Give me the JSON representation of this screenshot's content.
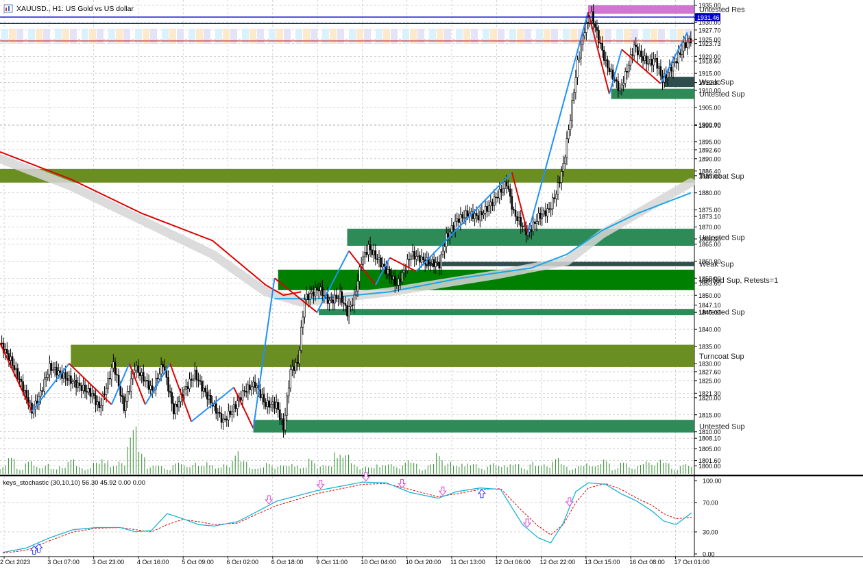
{
  "window": {
    "symbol_title": "XAUUSD., H1:  US Gold vs US dollar",
    "icon": "chart-window-icon"
  },
  "colors": {
    "bull_wick": "#000000",
    "zigzag_up": "#1e90ff",
    "zigzag_down": "#e00000",
    "ma_red": "#e00000",
    "ma_cyan": "#1aa6e6",
    "ma_band": "#d6d6d6",
    "zone_turncoat": "#6b8e23",
    "zone_untested": "#2e8b57",
    "zone_verified": "#008000",
    "zone_weak": "#2f4f4f",
    "zone_resist": "#cc66cc",
    "hline_blue": "#0000cc",
    "hline_red": "#c04040",
    "stoch_main": "#17b3d6",
    "stoch_signal": "#e00000",
    "arrow_up": "#2233ff",
    "arrow_down": "#e040e0",
    "volume": "#2e8b2e"
  },
  "chart_data": {
    "type": "candlestick",
    "symbol": "XAUUSD.",
    "timeframe": "H1",
    "description_text": "US Gold vs US dollar",
    "price_axis": {
      "ylim": [
        1797.5,
        1936.5
      ],
      "tick_labels": [
        "1935.00",
        "1931.46",
        "1930.00",
        "1927.70",
        "1925.00",
        "1923.73",
        "1920.00",
        "1918.60",
        "1915.00",
        "1912.30",
        "1910.00",
        "1905.00",
        "1900.00",
        "1899.70",
        "1895.00",
        "1892.60",
        "1890.00",
        "1886.40",
        "1885.00",
        "1880.00",
        "1875.00",
        "1873.10",
        "1870.00",
        "1866.50",
        "1865.00",
        "1860.00",
        "1855.00",
        "1853.60",
        "1850.00",
        "1847.10",
        "1845.00",
        "1840.00",
        "1835.00",
        "1830.00",
        "1827.60",
        "1825.00",
        "1821.30",
        "1820.00",
        "1815.00",
        "1810.00",
        "1808.10",
        "1805.00",
        "1801.60",
        "1800.00"
      ],
      "tick_values": [
        1935.0,
        1931.46,
        1930.0,
        1927.7,
        1925.0,
        1923.73,
        1920.0,
        1918.6,
        1915.0,
        1912.3,
        1910.0,
        1905.0,
        1900.0,
        1899.7,
        1895.0,
        1892.6,
        1890.0,
        1886.4,
        1885.0,
        1880.0,
        1875.0,
        1873.1,
        1870.0,
        1866.5,
        1865.0,
        1860.0,
        1855.0,
        1853.6,
        1850.0,
        1847.1,
        1845.0,
        1840.0,
        1835.0,
        1830.0,
        1827.6,
        1825.0,
        1821.3,
        1820.0,
        1815.0,
        1810.0,
        1808.1,
        1805.0,
        1801.6,
        1800.0
      ],
      "highlighted_label": "1931.46"
    },
    "time_axis": {
      "labels": [
        "2 Oct 2023",
        "3 Oct 07:00",
        "3 Oct 23:00",
        "4 Oct 16:00",
        "5 Oct 09:00",
        "6 Oct 02:00",
        "6 Oct 18:00",
        "9 Oct 11:00",
        "10 Oct 04:00",
        "10 Oct 20:00",
        "11 Oct 13:00",
        "12 Oct 06:00",
        "12 Oct 22:00",
        "13 Oct 15:00",
        "16 Oct 08:00",
        "17 Oct 01:00"
      ]
    },
    "price_path": [
      [
        0,
        1836
      ],
      [
        6,
        1831
      ],
      [
        12,
        1824
      ],
      [
        18,
        1816
      ],
      [
        22,
        1820
      ],
      [
        28,
        1829
      ],
      [
        34,
        1827
      ],
      [
        40,
        1825
      ],
      [
        46,
        1823
      ],
      [
        52,
        1821
      ],
      [
        56,
        1817
      ],
      [
        60,
        1823
      ],
      [
        64,
        1830
      ],
      [
        70,
        1817
      ],
      [
        76,
        1829
      ],
      [
        82,
        1825
      ],
      [
        86,
        1822
      ],
      [
        92,
        1830
      ],
      [
        98,
        1816
      ],
      [
        104,
        1822
      ],
      [
        110,
        1827
      ],
      [
        114,
        1823
      ],
      [
        120,
        1818
      ],
      [
        126,
        1813
      ],
      [
        132,
        1817
      ],
      [
        138,
        1822
      ],
      [
        144,
        1824
      ],
      [
        150,
        1818
      ],
      [
        156,
        1818
      ],
      [
        160,
        1811
      ],
      [
        164,
        1828
      ],
      [
        168,
        1830
      ],
      [
        172,
        1849
      ],
      [
        180,
        1852
      ],
      [
        186,
        1848
      ],
      [
        192,
        1850
      ],
      [
        196,
        1845
      ],
      [
        200,
        1849
      ],
      [
        204,
        1860
      ],
      [
        208,
        1864
      ],
      [
        214,
        1860
      ],
      [
        220,
        1856
      ],
      [
        224,
        1853
      ],
      [
        228,
        1857
      ],
      [
        232,
        1862
      ],
      [
        240,
        1860
      ],
      [
        248,
        1859
      ],
      [
        252,
        1867
      ],
      [
        258,
        1872
      ],
      [
        264,
        1874
      ],
      [
        270,
        1873
      ],
      [
        276,
        1876
      ],
      [
        282,
        1880
      ],
      [
        286,
        1883
      ],
      [
        290,
        1874
      ],
      [
        294,
        1871
      ],
      [
        298,
        1868
      ],
      [
        304,
        1873
      ],
      [
        310,
        1875
      ],
      [
        314,
        1880
      ],
      [
        318,
        1888
      ],
      [
        322,
        1902
      ],
      [
        326,
        1918
      ],
      [
        330,
        1928
      ],
      [
        334,
        1932
      ],
      [
        338,
        1925
      ],
      [
        342,
        1918
      ],
      [
        346,
        1914
      ],
      [
        350,
        1910
      ],
      [
        354,
        1916
      ],
      [
        358,
        1923
      ],
      [
        362,
        1920
      ],
      [
        366,
        1918
      ],
      [
        370,
        1919
      ],
      [
        374,
        1913
      ],
      [
        378,
        1916
      ],
      [
        382,
        1919
      ],
      [
        386,
        1923
      ],
      [
        390,
        1925
      ]
    ],
    "zigzag": [
      [
        0,
        1836,
        "down"
      ],
      [
        18,
        1816,
        "up"
      ],
      [
        39,
        1830,
        "down"
      ],
      [
        63,
        1818,
        "up"
      ],
      [
        73,
        1830,
        "down"
      ],
      [
        82,
        1818,
        "up"
      ],
      [
        96,
        1830,
        "down"
      ],
      [
        108,
        1813,
        "up"
      ],
      [
        132,
        1823,
        "down"
      ],
      [
        143,
        1811,
        "up"
      ],
      [
        155,
        1855,
        "down"
      ],
      [
        179,
        1845,
        "up"
      ],
      [
        197,
        1863,
        "down"
      ],
      [
        212,
        1853,
        "up"
      ],
      [
        220,
        1861,
        "down"
      ],
      [
        235,
        1857,
        "up"
      ],
      [
        289,
        1886,
        "down"
      ],
      [
        298,
        1868,
        "up"
      ],
      [
        332,
        1933,
        "down"
      ],
      [
        344,
        1909,
        "up"
      ],
      [
        351,
        1922,
        "down"
      ],
      [
        373,
        1912,
        "up"
      ],
      [
        388,
        1927,
        "end"
      ]
    ],
    "ma_red": [
      [
        0,
        1892
      ],
      [
        40,
        1884
      ],
      [
        80,
        1874
      ],
      [
        120,
        1866
      ],
      [
        150,
        1853
      ],
      [
        160,
        1850
      ],
      [
        170,
        1851
      ]
    ],
    "ma_cyan": [
      [
        155,
        1849
      ],
      [
        180,
        1849
      ],
      [
        220,
        1851
      ],
      [
        260,
        1855
      ],
      [
        300,
        1858
      ],
      [
        320,
        1862
      ],
      [
        340,
        1869
      ],
      [
        360,
        1874
      ],
      [
        390,
        1880
      ]
    ],
    "ma_band": [
      [
        0,
        1890
      ],
      [
        40,
        1882
      ],
      [
        80,
        1872
      ],
      [
        120,
        1862
      ],
      [
        150,
        1851
      ],
      [
        170,
        1848
      ],
      [
        220,
        1851
      ],
      [
        280,
        1856
      ],
      [
        320,
        1860
      ],
      [
        340,
        1868
      ],
      [
        370,
        1877
      ],
      [
        390,
        1883
      ]
    ],
    "zones": [
      {
        "label": "Untested Res",
        "kind": "resist",
        "from": 1932.5,
        "to": 1935.0,
        "start": 332
      },
      {
        "label": "Weak Sup",
        "kind": "weak",
        "from": 1911.0,
        "to": 1914.0,
        "start": 375
      },
      {
        "label": "Untested Sup",
        "kind": "untested",
        "from": 1907.5,
        "to": 1910.5,
        "start": 345
      },
      {
        "label": "Turncoat Sup",
        "kind": "turncoat",
        "from": 1883.0,
        "to": 1887.0,
        "start": 0
      },
      {
        "label": "Untested Sup",
        "kind": "untested",
        "from": 1864.5,
        "to": 1869.5,
        "start": 196
      },
      {
        "label": "Weak Sup",
        "kind": "weak",
        "from": 1858.5,
        "to": 1859.8,
        "start": 240
      },
      {
        "label": "Verified Sup, Retests=1",
        "kind": "verified",
        "from": 1851.5,
        "to": 1857.5,
        "start": 157
      },
      {
        "label": "Untested Sup",
        "kind": "untested",
        "from": 1844.2,
        "to": 1846.0,
        "start": 180
      },
      {
        "label": "Turncoat Sup",
        "kind": "turncoat",
        "from": 1829.0,
        "to": 1835.5,
        "start": 40
      },
      {
        "label": "Untested Sup",
        "kind": "untested",
        "from": 1809.8,
        "to": 1813.5,
        "start": 143
      }
    ],
    "hlines": [
      {
        "price": 1931.5,
        "color": "blue"
      },
      {
        "price": 1929.6,
        "color": "blue"
      },
      {
        "price": 1924.5,
        "color": "red"
      }
    ],
    "volume": [
      6,
      10,
      4,
      8,
      5,
      7,
      3,
      6,
      9,
      5,
      4,
      7,
      12,
      5,
      8,
      30,
      14,
      6,
      5,
      4,
      7,
      6,
      8,
      5,
      9,
      4,
      6,
      16,
      8,
      5,
      4,
      7,
      6,
      5,
      8,
      4,
      10,
      6,
      5,
      18,
      12,
      7,
      5,
      4,
      8,
      6,
      5,
      9,
      7,
      4,
      6,
      14,
      8,
      5,
      9,
      6,
      4,
      7,
      5,
      8,
      6,
      4,
      9,
      5,
      7,
      10,
      6,
      4,
      5,
      8,
      6,
      9,
      4,
      7,
      5,
      6,
      8,
      10,
      7,
      4,
      6,
      5
    ],
    "stochastic": {
      "title": "keys_stochastic (30,10,10) 56.30 45.92 0.00 0.00",
      "ylim": [
        0,
        100
      ],
      "tick_labels": [
        "100.00",
        "70.00",
        "30.00",
        "0.00"
      ],
      "tick_values": [
        100,
        70,
        30,
        0
      ],
      "main": [
        [
          0,
          2
        ],
        [
          15,
          8
        ],
        [
          30,
          22
        ],
        [
          45,
          33
        ],
        [
          60,
          36
        ],
        [
          75,
          36
        ],
        [
          85,
          30
        ],
        [
          95,
          32
        ],
        [
          105,
          55
        ],
        [
          115,
          48
        ],
        [
          125,
          40
        ],
        [
          135,
          38
        ],
        [
          150,
          44
        ],
        [
          160,
          55
        ],
        [
          175,
          72
        ],
        [
          200,
          86
        ],
        [
          230,
          98
        ],
        [
          245,
          97
        ],
        [
          260,
          84
        ],
        [
          278,
          76
        ],
        [
          290,
          85
        ],
        [
          305,
          90
        ],
        [
          318,
          88
        ],
        [
          332,
          40
        ],
        [
          342,
          22
        ],
        [
          350,
          15
        ],
        [
          358,
          42
        ],
        [
          366,
          85
        ],
        [
          374,
          97
        ],
        [
          385,
          95
        ],
        [
          395,
          82
        ],
        [
          405,
          72
        ],
        [
          415,
          58
        ],
        [
          422,
          45
        ],
        [
          430,
          40
        ],
        [
          440,
          56
        ]
      ],
      "signal": [
        [
          0,
          1
        ],
        [
          15,
          5
        ],
        [
          30,
          18
        ],
        [
          45,
          30
        ],
        [
          60,
          35
        ],
        [
          75,
          36
        ],
        [
          85,
          33
        ],
        [
          95,
          30
        ],
        [
          105,
          40
        ],
        [
          115,
          47
        ],
        [
          125,
          44
        ],
        [
          135,
          40
        ],
        [
          150,
          42
        ],
        [
          160,
          52
        ],
        [
          175,
          66
        ],
        [
          200,
          82
        ],
        [
          230,
          95
        ],
        [
          245,
          96
        ],
        [
          260,
          88
        ],
        [
          278,
          78
        ],
        [
          290,
          82
        ],
        [
          305,
          88
        ],
        [
          318,
          89
        ],
        [
          332,
          58
        ],
        [
          342,
          38
        ],
        [
          350,
          26
        ],
        [
          358,
          40
        ],
        [
          366,
          70
        ],
        [
          374,
          90
        ],
        [
          385,
          96
        ],
        [
          395,
          88
        ],
        [
          405,
          76
        ],
        [
          415,
          66
        ],
        [
          422,
          55
        ],
        [
          430,
          48
        ],
        [
          440,
          50
        ]
      ],
      "arrows": [
        [
          20,
          "up"
        ],
        [
          23,
          "up"
        ],
        [
          170,
          "down"
        ],
        [
          203,
          "down"
        ],
        [
          232,
          "down"
        ],
        [
          255,
          "down"
        ],
        [
          281,
          "down"
        ],
        [
          306,
          "up"
        ],
        [
          335,
          "down"
        ],
        [
          362,
          "down"
        ]
      ]
    }
  }
}
